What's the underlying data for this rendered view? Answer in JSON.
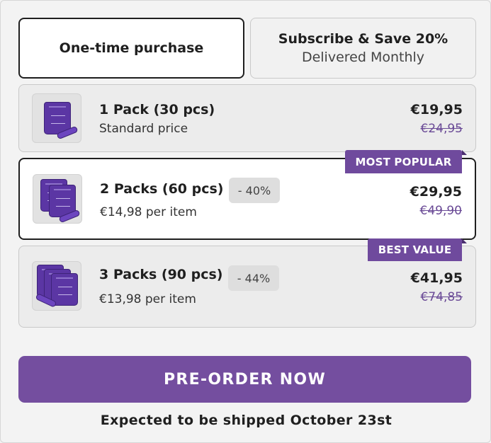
{
  "purchase_mode": {
    "one_time": {
      "label": "One-time purchase"
    },
    "subscribe": {
      "title": "Subscribe & Save 20%",
      "caption": "Delivered Monthly"
    }
  },
  "options": [
    {
      "name": "1 Pack (30 pcs)",
      "subtext": "Standard price",
      "price": "€19,95",
      "old_price": "€24,95"
    },
    {
      "name": "2 Packs (60 pcs)",
      "discount": "- 40%",
      "subtext": "€14,98 per item",
      "price": "€29,95",
      "old_price": "€49,90",
      "ribbon": "MOST POPULAR"
    },
    {
      "name": "3 Packs (90 pcs)",
      "discount": "- 44%",
      "subtext": "€13,98 per item",
      "price": "€41,95",
      "old_price": "€74,85",
      "ribbon": "BEST VALUE"
    }
  ],
  "cta": {
    "label": "PRE-ORDER NOW"
  },
  "shipping_note": "Expected to be shipped October 23st",
  "colors": {
    "accent": "#744e9f",
    "ribbon": "#6f4a9d",
    "old_price": "#6a4a96",
    "selected_border": "#1f1f1f"
  },
  "icons": {
    "product_image": "purple-pouch-product-image"
  }
}
